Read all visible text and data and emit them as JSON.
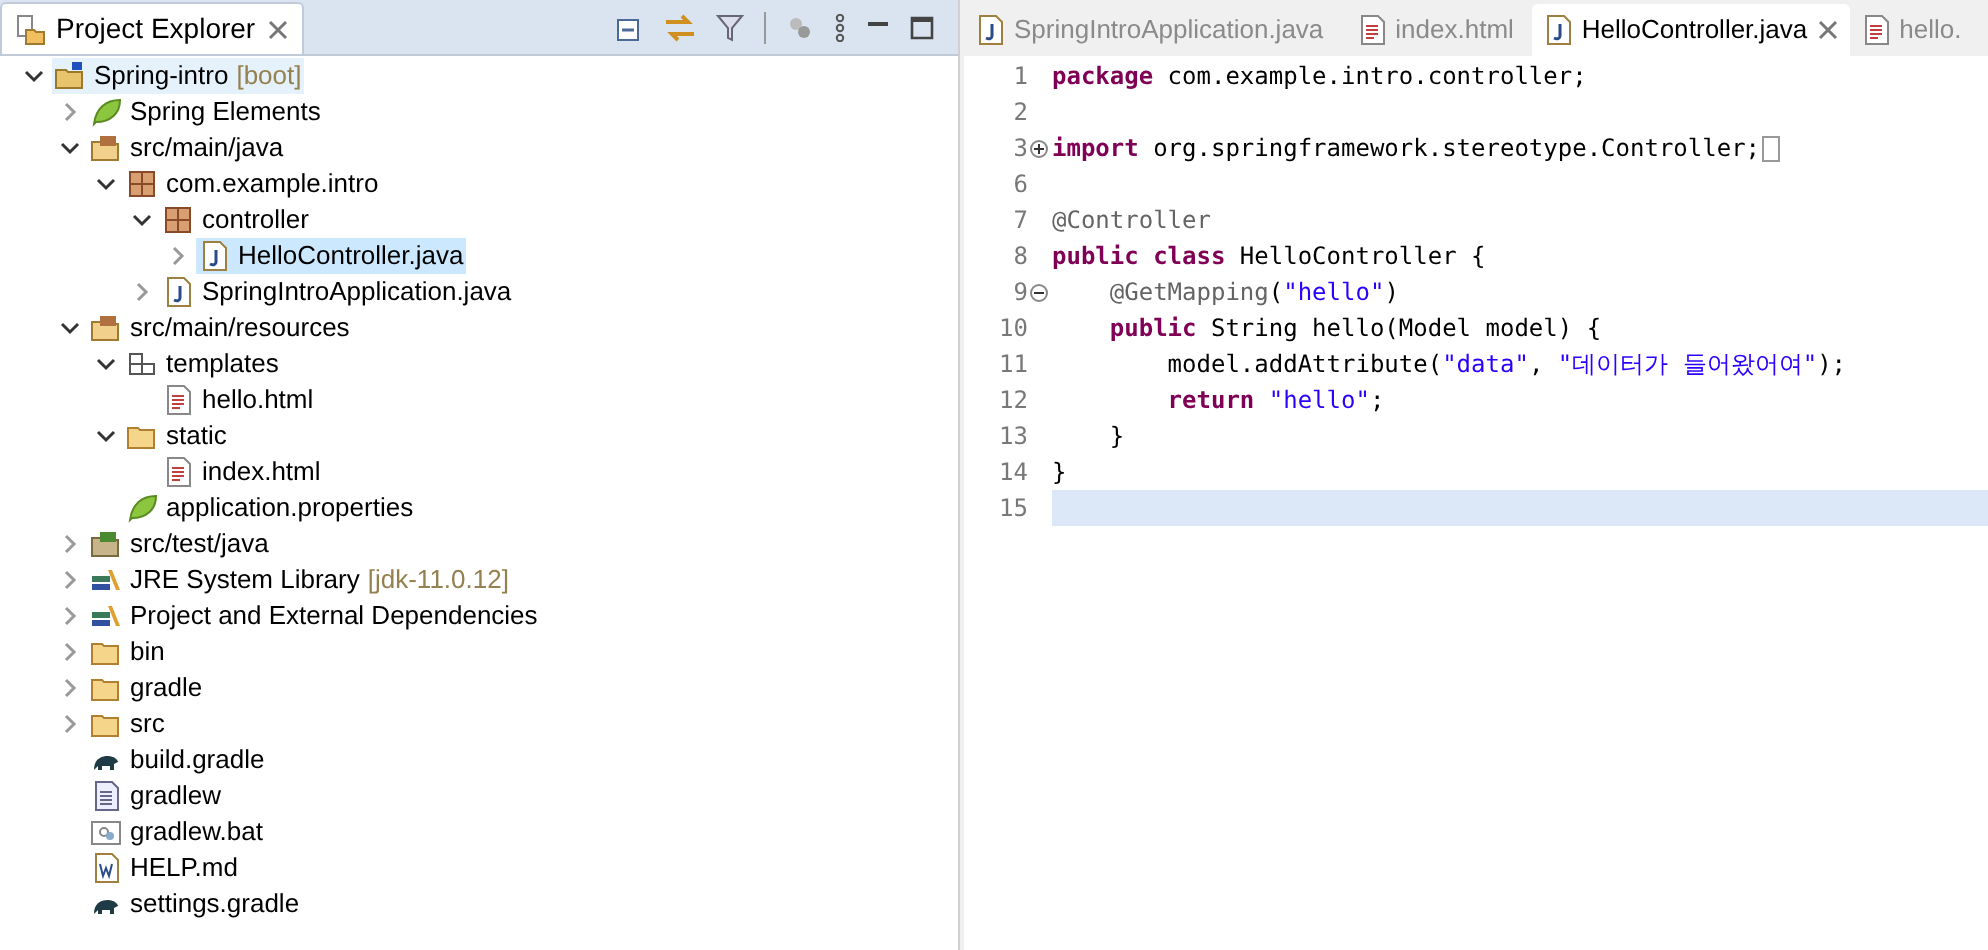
{
  "explorer": {
    "title": "Project Explorer",
    "tree": [
      {
        "label": "Spring-intro",
        "decoration": "[boot]",
        "kind": "project",
        "expanded": true,
        "selected": false,
        "highlight": true,
        "children": [
          {
            "label": "Spring Elements",
            "kind": "leaf",
            "expanded": false,
            "selected": false
          },
          {
            "label": "src/main/java",
            "kind": "source-folder",
            "expanded": true,
            "selected": false,
            "children": [
              {
                "label": "com.example.intro",
                "kind": "package",
                "expanded": true,
                "selected": false,
                "children": [
                  {
                    "label": "controller",
                    "kind": "package",
                    "expanded": true,
                    "selected": false,
                    "children": [
                      {
                        "label": "HelloController.java",
                        "kind": "java",
                        "expanded": false,
                        "selected": true
                      }
                    ]
                  },
                  {
                    "label": "SpringIntroApplication.java",
                    "kind": "java",
                    "expanded": false,
                    "selected": false
                  }
                ]
              }
            ]
          },
          {
            "label": "src/main/resources",
            "kind": "source-folder",
            "expanded": true,
            "selected": false,
            "children": [
              {
                "label": "templates",
                "kind": "template-folder",
                "expanded": true,
                "selected": false,
                "children": [
                  {
                    "label": "hello.html",
                    "kind": "html",
                    "selected": false
                  }
                ]
              },
              {
                "label": "static",
                "kind": "folder",
                "expanded": true,
                "selected": false,
                "children": [
                  {
                    "label": "index.html",
                    "kind": "html",
                    "selected": false
                  }
                ]
              },
              {
                "label": "application.properties",
                "kind": "leaf",
                "selected": false
              }
            ]
          },
          {
            "label": "src/test/java",
            "kind": "test-folder",
            "expanded": false,
            "selected": false
          },
          {
            "label": "JRE System Library",
            "decoration": "[jdk-11.0.12]",
            "kind": "library",
            "expanded": false,
            "selected": false
          },
          {
            "label": "Project and External Dependencies",
            "kind": "library",
            "expanded": false,
            "selected": false
          },
          {
            "label": "bin",
            "kind": "folder",
            "expanded": false,
            "selected": false
          },
          {
            "label": "gradle",
            "kind": "folder",
            "expanded": false,
            "selected": false
          },
          {
            "label": "src",
            "kind": "folder",
            "expanded": false,
            "selected": false
          },
          {
            "label": "build.gradle",
            "kind": "gradle",
            "selected": false
          },
          {
            "label": "gradlew",
            "kind": "text",
            "selected": false
          },
          {
            "label": "gradlew.bat",
            "kind": "bat",
            "selected": false
          },
          {
            "label": "HELP.md",
            "kind": "word",
            "selected": false
          },
          {
            "label": "settings.gradle",
            "kind": "gradle",
            "selected": false
          }
        ]
      }
    ]
  },
  "editor": {
    "tabs": [
      {
        "label": "SpringIntroApplication.java",
        "kind": "java",
        "selected": false
      },
      {
        "label": "index.html",
        "kind": "html",
        "selected": false
      },
      {
        "label": "HelloController.java",
        "kind": "java",
        "selected": true
      },
      {
        "label": "hello.",
        "kind": "html",
        "selected": false
      }
    ],
    "lines": [
      {
        "number": "1",
        "current": false,
        "tokens": [
          {
            "kind": "keyword",
            "text": "package"
          },
          {
            "kind": "plain",
            "text": " com.example.intro.controller;"
          }
        ]
      },
      {
        "number": "2",
        "current": false
      },
      {
        "number": "3",
        "fold_expanded": false,
        "current": false,
        "folded_marker": true,
        "tokens": [
          {
            "kind": "keyword",
            "text": "import"
          },
          {
            "kind": "plain",
            "text": " org.springframework.stereotype.Controller;"
          }
        ]
      },
      {
        "number": "6",
        "current": false
      },
      {
        "number": "7",
        "current": false,
        "tokens": [
          {
            "kind": "annotation",
            "text": "@Controller"
          }
        ]
      },
      {
        "number": "8",
        "current": false,
        "tokens": [
          {
            "kind": "keyword",
            "text": "public class"
          },
          {
            "kind": "plain",
            "text": " HelloController {"
          }
        ]
      },
      {
        "number": "9",
        "fold_expanded": true,
        "current": false,
        "tokens": [
          {
            "kind": "annotation",
            "text": "    @GetMapping"
          },
          {
            "kind": "plain",
            "text": "("
          },
          {
            "kind": "string",
            "text": "\"hello\""
          },
          {
            "kind": "plain",
            "text": ")"
          }
        ]
      },
      {
        "number": "10",
        "current": false,
        "tokens": [
          {
            "kind": "keyword",
            "text": "    public"
          },
          {
            "kind": "plain",
            "text": " String hello(Model model) {"
          }
        ]
      },
      {
        "number": "11",
        "current": false,
        "tokens": [
          {
            "kind": "plain",
            "text": "        model.addAttribute("
          },
          {
            "kind": "string",
            "text": "\"data\""
          },
          {
            "kind": "plain",
            "text": ", "
          },
          {
            "kind": "string",
            "text": "\"데이터가 들어왔어여\""
          },
          {
            "kind": "plain",
            "text": ");"
          }
        ]
      },
      {
        "number": "12",
        "current": false,
        "tokens": [
          {
            "kind": "keyword",
            "text": "        return"
          },
          {
            "kind": "string",
            "text": " \"hello\""
          },
          {
            "kind": "plain",
            "text": ";"
          }
        ]
      },
      {
        "number": "13",
        "current": false,
        "tokens": [
          {
            "kind": "plain",
            "text": "    }"
          }
        ]
      },
      {
        "number": "14",
        "current": false,
        "tokens": [
          {
            "kind": "plain",
            "text": "}"
          }
        ]
      },
      {
        "number": "15",
        "current": true
      }
    ]
  }
}
